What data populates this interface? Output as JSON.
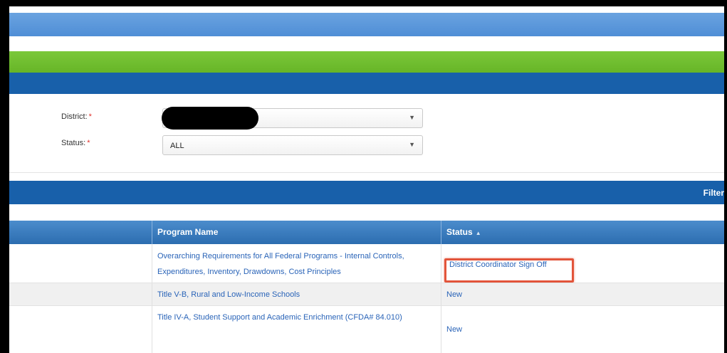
{
  "form": {
    "district_label": "District:",
    "district_required": "*",
    "district_value": "",
    "status_label": "Status:",
    "status_required": "*",
    "status_value": "ALL"
  },
  "toolbar": {
    "filter_label": "Filter"
  },
  "grid": {
    "columns": [
      "Program Name",
      "Status"
    ],
    "sort_indicator": "▲",
    "rows": [
      {
        "program": "Overarching Requirements for All Federal Programs - Internal Controls, Expenditures, Inventory, Drawdowns, Cost Principles",
        "status": "District Coordinator Sign Off"
      },
      {
        "program": "Title V-B, Rural and Low-Income Schools",
        "status": "New"
      },
      {
        "program": "Title IV-A, Student Support and Academic Enrichment (CFDA# 84.010)",
        "status": "New"
      }
    ]
  },
  "colors": {
    "top_band": "#5a97da",
    "green_band": "#70bd30",
    "navy_band": "#1860aa",
    "link": "#2a64b8",
    "highlight": "#e2543a"
  },
  "icons": {
    "dropdown": "chevron-down-icon",
    "sort": "sort-ascending-icon"
  }
}
